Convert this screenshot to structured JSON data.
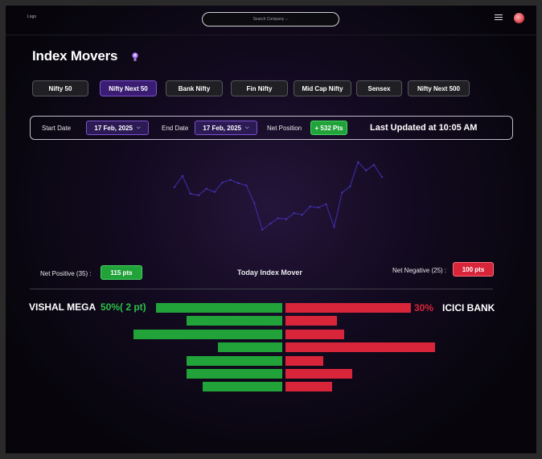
{
  "header": {
    "logo": "Logo",
    "search_placeholder": "Search Company ⌵"
  },
  "page": {
    "title": "Index Movers"
  },
  "tabs": [
    {
      "label": "Nifty 50",
      "active": false
    },
    {
      "label": "Nifty Next 50",
      "active": true
    },
    {
      "label": "Bank Nifty",
      "active": false
    },
    {
      "label": "Fin Nifty",
      "active": false
    },
    {
      "label": "Mid Cap Nifty",
      "active": false
    },
    {
      "label": "Sensex",
      "active": false
    },
    {
      "label": "Nifty Next 500",
      "active": false
    }
  ],
  "filters": {
    "start_label": "Start Date",
    "start_value": "17 Feb, 2025",
    "end_label": "End Date",
    "end_value": "17 Feb, 2025",
    "net_label": "Net Position",
    "net_value": "+ 532 Pts",
    "updated": "Last Updated at 10:05 AM"
  },
  "chart_data": {
    "type": "line",
    "values": [
      16,
      36,
      4,
      1,
      13,
      7,
      24,
      29,
      23,
      19,
      -13,
      -61,
      -50,
      -40,
      -42,
      -31,
      -34,
      -19,
      -21,
      -15,
      -56,
      6,
      17,
      61,
      46,
      56,
      34
    ],
    "y_tick_labels": [
      "",
      "",
      " ",
      " ",
      "",
      ""
    ],
    "x_tick_labels": [
      "",
      "",
      "",
      "",
      "",
      ""
    ],
    "grid": false,
    "line_color": "#3b2a9e"
  },
  "summary": {
    "net_positive_label": "Net Positive (35) :",
    "net_positive_value": "115 pts",
    "title": "Today Index Mover",
    "net_negative_label": "Net Negative (25) :",
    "net_negative_value": "100 pts"
  },
  "movers": {
    "left_name": "VISHAL MEGA",
    "left_pct": "50%( 2 pt)",
    "right_pct": "30%",
    "right_name": "ICICI BANK",
    "gainers": [
      157,
      119,
      185,
      80,
      119,
      119,
      99
    ],
    "losers": [
      156,
      64,
      73,
      186,
      47,
      83,
      58
    ]
  },
  "colors": {
    "positive": "#22a33a",
    "negative": "#d8253a",
    "accent": "#3a1d72"
  }
}
